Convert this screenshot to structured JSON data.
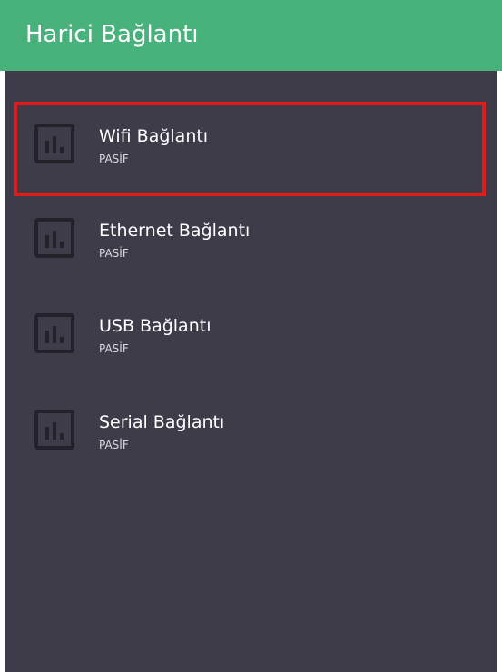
{
  "colors": {
    "app_bar": "#48b27d",
    "background": "#3e3c48",
    "selection_border": "#e41b1b",
    "icon": "#23212a",
    "title_text": "#ffffff",
    "status_text": "#d9d8de"
  },
  "app_bar": {
    "title": "Harici Bağlantı"
  },
  "connections": {
    "items": [
      {
        "title": "Wifi Bağlantı",
        "status": "PASİF",
        "icon": "bar-chart-icon",
        "selected": true
      },
      {
        "title": "Ethernet Bağlantı",
        "status": "PASİF",
        "icon": "bar-chart-icon",
        "selected": false
      },
      {
        "title": "USB Bağlantı",
        "status": "PASİF",
        "icon": "bar-chart-icon",
        "selected": false
      },
      {
        "title": "Serial Bağlantı",
        "status": "PASİF",
        "icon": "bar-chart-icon",
        "selected": false
      }
    ]
  }
}
